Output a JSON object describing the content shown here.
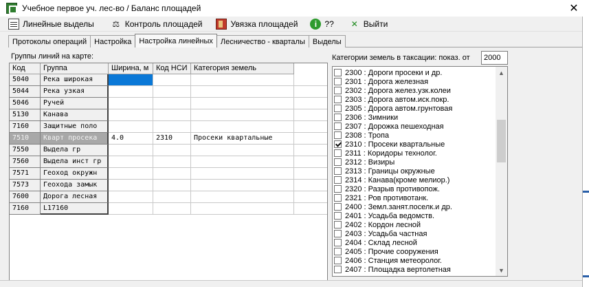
{
  "window": {
    "title": "Учебное первое уч. лес-во / Баланс площадей",
    "close_glyph": "✕"
  },
  "toolbar": {
    "items": [
      {
        "label": "Линейные выделы",
        "icon": "lines-icon"
      },
      {
        "label": "Контроль площадей",
        "icon": "scales-icon"
      },
      {
        "label": "Увязка площадей",
        "icon": "book-icon"
      },
      {
        "label": "??",
        "icon": "info-icon"
      },
      {
        "label": "Выйти",
        "icon": "exit-icon"
      }
    ]
  },
  "tabs": [
    {
      "label": "Протоколы операций",
      "active": false
    },
    {
      "label": "Настройка",
      "active": false
    },
    {
      "label": "Настройка линейных",
      "active": true
    },
    {
      "label": "Лесничество - кварталы",
      "active": false
    },
    {
      "label": "Выделы",
      "active": false
    }
  ],
  "left": {
    "label": "Группы линий на карте:",
    "columns": [
      "Код",
      "Группа",
      "Ширина, м",
      "Код НСИ",
      "Категория земель"
    ],
    "rows": [
      {
        "code": "5040",
        "group": "Река широкая",
        "width": "",
        "nsi": "",
        "category": ""
      },
      {
        "code": "5044",
        "group": "Река узкая",
        "width": "",
        "nsi": "",
        "category": ""
      },
      {
        "code": "5046",
        "group": "Ручей",
        "width": "",
        "nsi": "",
        "category": ""
      },
      {
        "code": "5130",
        "group": "Канава",
        "width": "",
        "nsi": "",
        "category": ""
      },
      {
        "code": "7160",
        "group": "Защитные поло",
        "width": "",
        "nsi": "",
        "category": ""
      },
      {
        "code": "7510",
        "group": "Кварт просека",
        "width": "4.0",
        "nsi": "2310",
        "category": "Просеки квартальные"
      },
      {
        "code": "7550",
        "group": "Выдела гр",
        "width": "",
        "nsi": "",
        "category": ""
      },
      {
        "code": "7560",
        "group": "Выдела инст гр",
        "width": "",
        "nsi": "",
        "category": ""
      },
      {
        "code": "7571",
        "group": "Геоход окружн",
        "width": "",
        "nsi": "",
        "category": ""
      },
      {
        "code": "7573",
        "group": "Геохода замык",
        "width": "",
        "nsi": "",
        "category": ""
      },
      {
        "code": "7600",
        "group": "Дорога лесная",
        "width": "",
        "nsi": "",
        "category": ""
      },
      {
        "code": "7160",
        "group": "L17160",
        "width": "",
        "nsi": "",
        "category": ""
      }
    ]
  },
  "right": {
    "label": "Категории земель в таксации:  показ. от",
    "filter_value": "2000",
    "items": [
      {
        "label": "2300 : Дороги просеки и др.",
        "checked": false
      },
      {
        "label": "2301 : Дорога железная",
        "checked": false
      },
      {
        "label": "2302 : Дорога желез.узк.колеи",
        "checked": false
      },
      {
        "label": "2303 : Дорога автом.иск.покр.",
        "checked": false
      },
      {
        "label": "2305 : Дорога автом.грунтовая",
        "checked": false
      },
      {
        "label": "2306 : Зимники",
        "checked": false
      },
      {
        "label": "2307 : Дорожка пешеходная",
        "checked": false
      },
      {
        "label": "2308 : Тропа",
        "checked": false
      },
      {
        "label": "2310 : Просеки квартальные",
        "checked": true
      },
      {
        "label": "2311 : Коридоры технолог.",
        "checked": false
      },
      {
        "label": "2312 : Визиры",
        "checked": false
      },
      {
        "label": "2313 : Границы окружные",
        "checked": false
      },
      {
        "label": "2314 : Канава(кроме мелиор.)",
        "checked": false
      },
      {
        "label": "2320 : Разрыв противопож.",
        "checked": false
      },
      {
        "label": "2321 : Ров противотанк.",
        "checked": false
      },
      {
        "label": "2400 : Земл.занят.поселк.и др.",
        "checked": false
      },
      {
        "label": "2401 : Усадьба ведомств.",
        "checked": false
      },
      {
        "label": "2402 : Кордон лесной",
        "checked": false
      },
      {
        "label": "2403 : Усадьба частная",
        "checked": false
      },
      {
        "label": "2404 : Склад лесной",
        "checked": false
      },
      {
        "label": "2405 : Прочие сооружения",
        "checked": false
      },
      {
        "label": "2406 : Станция метеоролог.",
        "checked": false
      },
      {
        "label": "2407 : Площадка вертолетная",
        "checked": false
      }
    ]
  }
}
